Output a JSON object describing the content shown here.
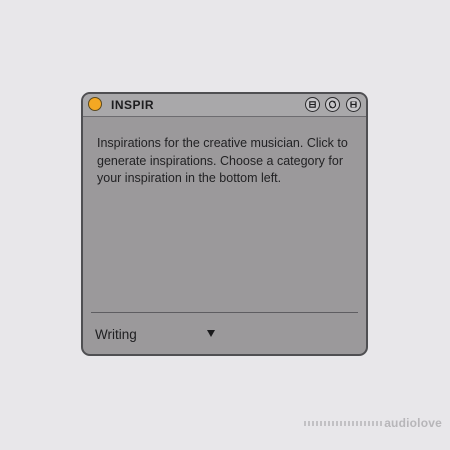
{
  "window": {
    "title": "INSPIR",
    "led_color": "#f4a823",
    "buttons": [
      "expand-icon",
      "refresh-icon",
      "save-icon"
    ]
  },
  "main": {
    "description": "Inspirations for the creative musician. Click to generate inspirations. Choose a category for your inspiration in the bottom left."
  },
  "footer": {
    "category": "Writing"
  },
  "watermark": {
    "text": "audiolove"
  }
}
